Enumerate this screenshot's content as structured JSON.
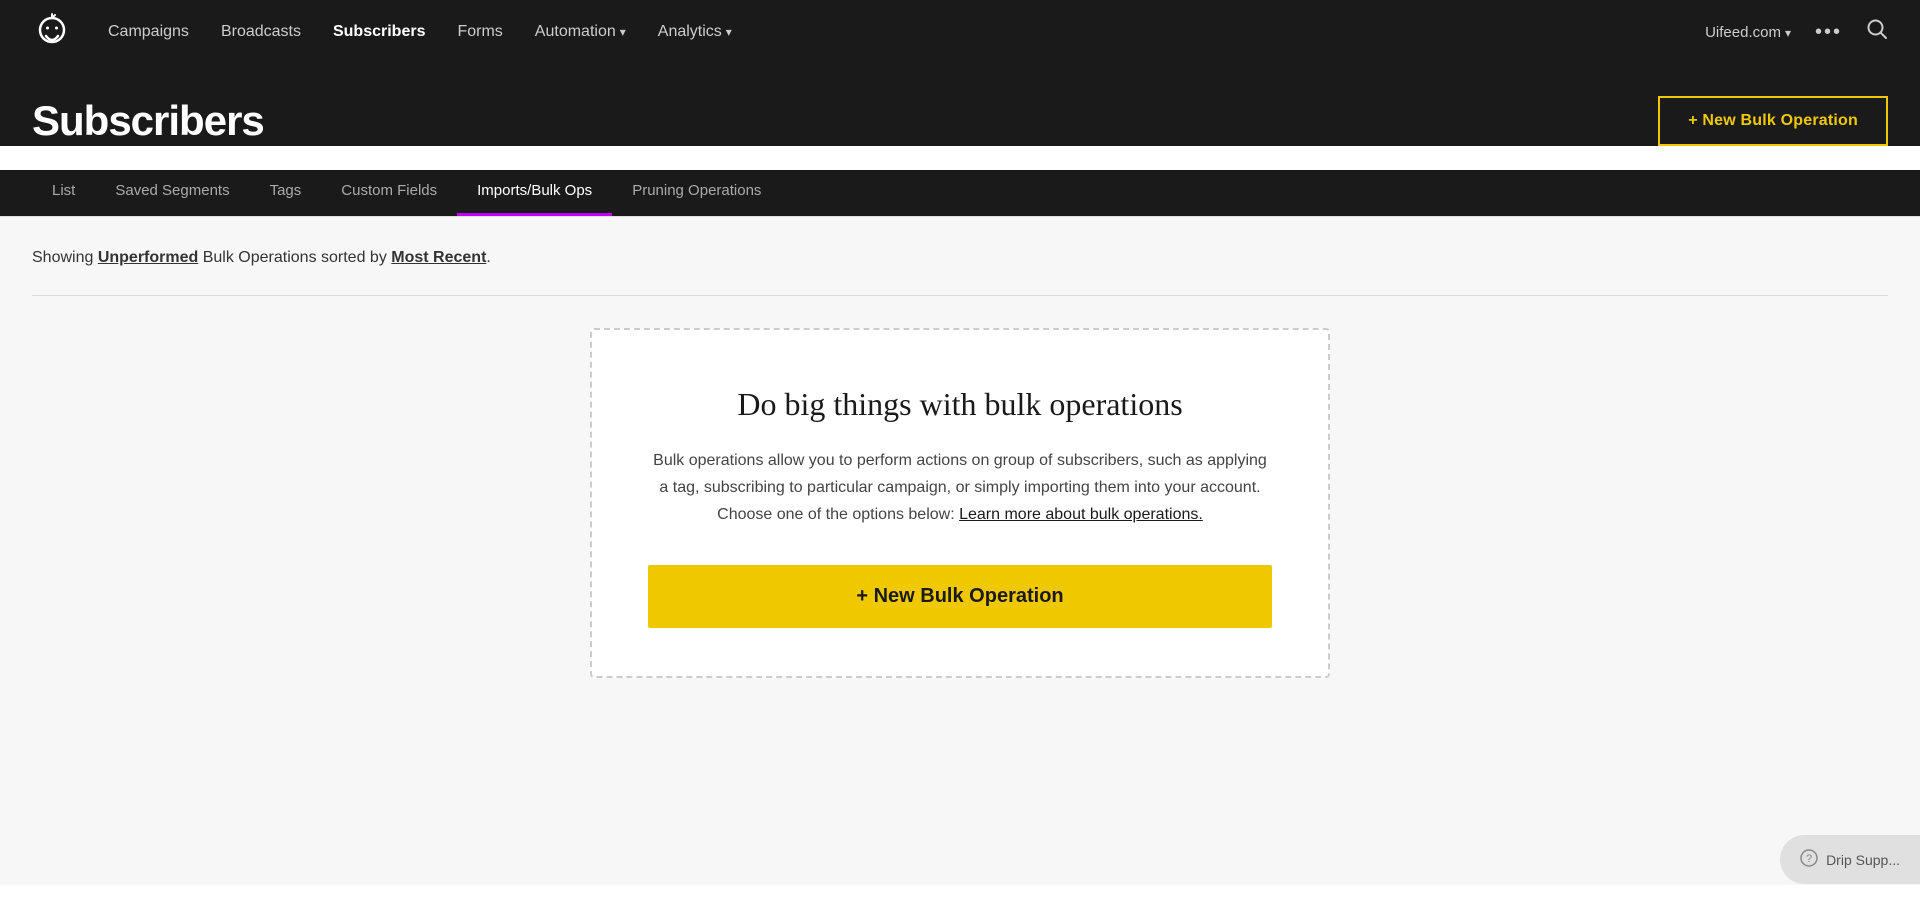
{
  "nav": {
    "logo_text": "☻",
    "links": [
      {
        "label": "Campaigns",
        "active": false
      },
      {
        "label": "Broadcasts",
        "active": false
      },
      {
        "label": "Subscribers",
        "active": true
      },
      {
        "label": "Forms",
        "active": false
      },
      {
        "label": "Automation",
        "active": false,
        "has_arrow": true
      },
      {
        "label": "Analytics",
        "active": false,
        "has_arrow": true
      }
    ],
    "domain": "Uifeed.com",
    "dots": "•••"
  },
  "header": {
    "title": "Subscribers",
    "new_bulk_label": "+ New Bulk Operation"
  },
  "tabs": [
    {
      "label": "List",
      "active": false
    },
    {
      "label": "Saved Segments",
      "active": false
    },
    {
      "label": "Tags",
      "active": false
    },
    {
      "label": "Custom Fields",
      "active": false
    },
    {
      "label": "Imports/Bulk Ops",
      "active": true
    },
    {
      "label": "Pruning Operations",
      "active": false
    }
  ],
  "filter": {
    "text_prefix": "Showing ",
    "highlight1": "Unperformed",
    "text_middle": " Bulk Operations sorted by ",
    "highlight2": "Most Recent",
    "text_suffix": "."
  },
  "empty_state": {
    "title": "Do big things with bulk operations",
    "description_prefix": "Bulk operations allow you to perform actions on group of subscribers, such as applying a tag, subscribing to particular campaign, or simply importing them into your account. Choose one of the options below: ",
    "link_text": "Learn more about bulk operations.",
    "new_bulk_button": "+ New Bulk Operation"
  },
  "drip_support": {
    "label": "Drip Supp..."
  }
}
